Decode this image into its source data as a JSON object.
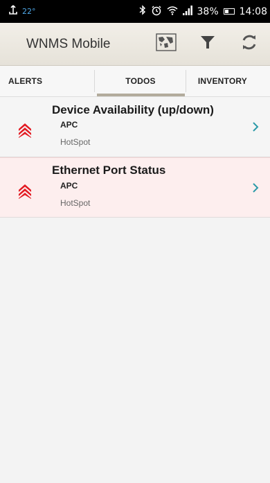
{
  "status_bar": {
    "temperature": "22°",
    "battery": "38%",
    "time": "14:08",
    "icons": [
      "usb-icon",
      "bluetooth-icon",
      "alarm-icon",
      "wifi-icon",
      "signal-icon",
      "battery-icon"
    ]
  },
  "app_bar": {
    "title": "WNMS Mobile",
    "actions": [
      "map-icon",
      "filter-icon",
      "refresh-icon"
    ]
  },
  "tabs": [
    {
      "label": "ALERTS",
      "selected": false
    },
    {
      "label": "TODOS",
      "selected": true
    },
    {
      "label": "INVENTORY",
      "selected": false
    }
  ],
  "todos": [
    {
      "title": "Device Availability (up/down)",
      "vendor": "APC",
      "type": "HotSpot"
    },
    {
      "title": "Ethernet Port Status",
      "vendor": "APC",
      "type": "HotSpot"
    }
  ],
  "colors": {
    "severity": "#e31b23",
    "chevron": "#2b9aa8",
    "tab_indicator": "#b2ab9c",
    "highlight_row": "#fdeeee"
  }
}
